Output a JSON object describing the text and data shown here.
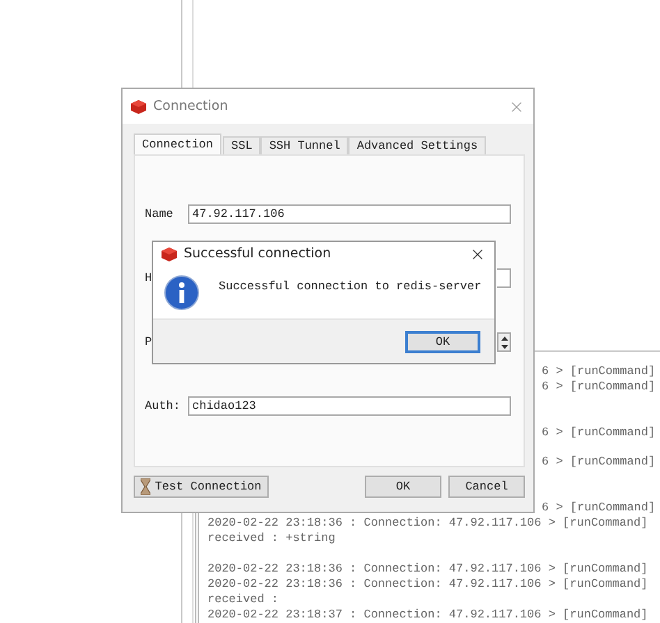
{
  "log": {
    "lines": [
      {
        "kind": "covered",
        "text": "6 > [runCommand]"
      },
      {
        "kind": "covered",
        "text": "6 > [runCommand]"
      },
      {
        "kind": "blank"
      },
      {
        "kind": "blank"
      },
      {
        "kind": "covered",
        "text": "6 > [runCommand]"
      },
      {
        "kind": "blank"
      },
      {
        "kind": "covered",
        "text": "6 > [runCommand]"
      },
      {
        "kind": "blank"
      },
      {
        "kind": "blank"
      },
      {
        "kind": "covered",
        "text": "6 > [runCommand]"
      },
      {
        "kind": "full",
        "text": "2020-02-22 23:18:36 : Connection: 47.92.117.106 > [runCommand]"
      },
      {
        "kind": "full",
        "text": "received : +string"
      },
      {
        "kind": "blank"
      },
      {
        "kind": "full",
        "text": "2020-02-22 23:18:36 : Connection: 47.92.117.106 > [runCommand]"
      },
      {
        "kind": "full",
        "text": "2020-02-22 23:18:36 : Connection: 47.92.117.106 > [runCommand]"
      },
      {
        "kind": "full",
        "text": "received :"
      },
      {
        "kind": "full",
        "text": "2020-02-22 23:18:37 : Connection: 47.92.117.106 > [runCommand]"
      }
    ]
  },
  "dialog": {
    "title": "Connection",
    "tabs": [
      {
        "label": "Connection",
        "selected": true
      },
      {
        "label": "SSL",
        "selected": false
      },
      {
        "label": "SSH Tunnel",
        "selected": false
      },
      {
        "label": "Advanced Settings",
        "selected": false
      }
    ],
    "fields": [
      {
        "kind": "text",
        "label": "Name",
        "value": "47.92.117.106"
      },
      {
        "kind": "sliver",
        "label": "H"
      },
      {
        "kind": "spin",
        "label": "P"
      },
      {
        "kind": "text",
        "label": "Auth:",
        "value": "chidao123"
      }
    ],
    "test_button": "Test Connection",
    "ok_button": "OK",
    "cancel_button": "Cancel"
  },
  "message_box": {
    "title": "Successful connection",
    "message": "Successful connection to redis-server",
    "ok_button": "OK"
  }
}
